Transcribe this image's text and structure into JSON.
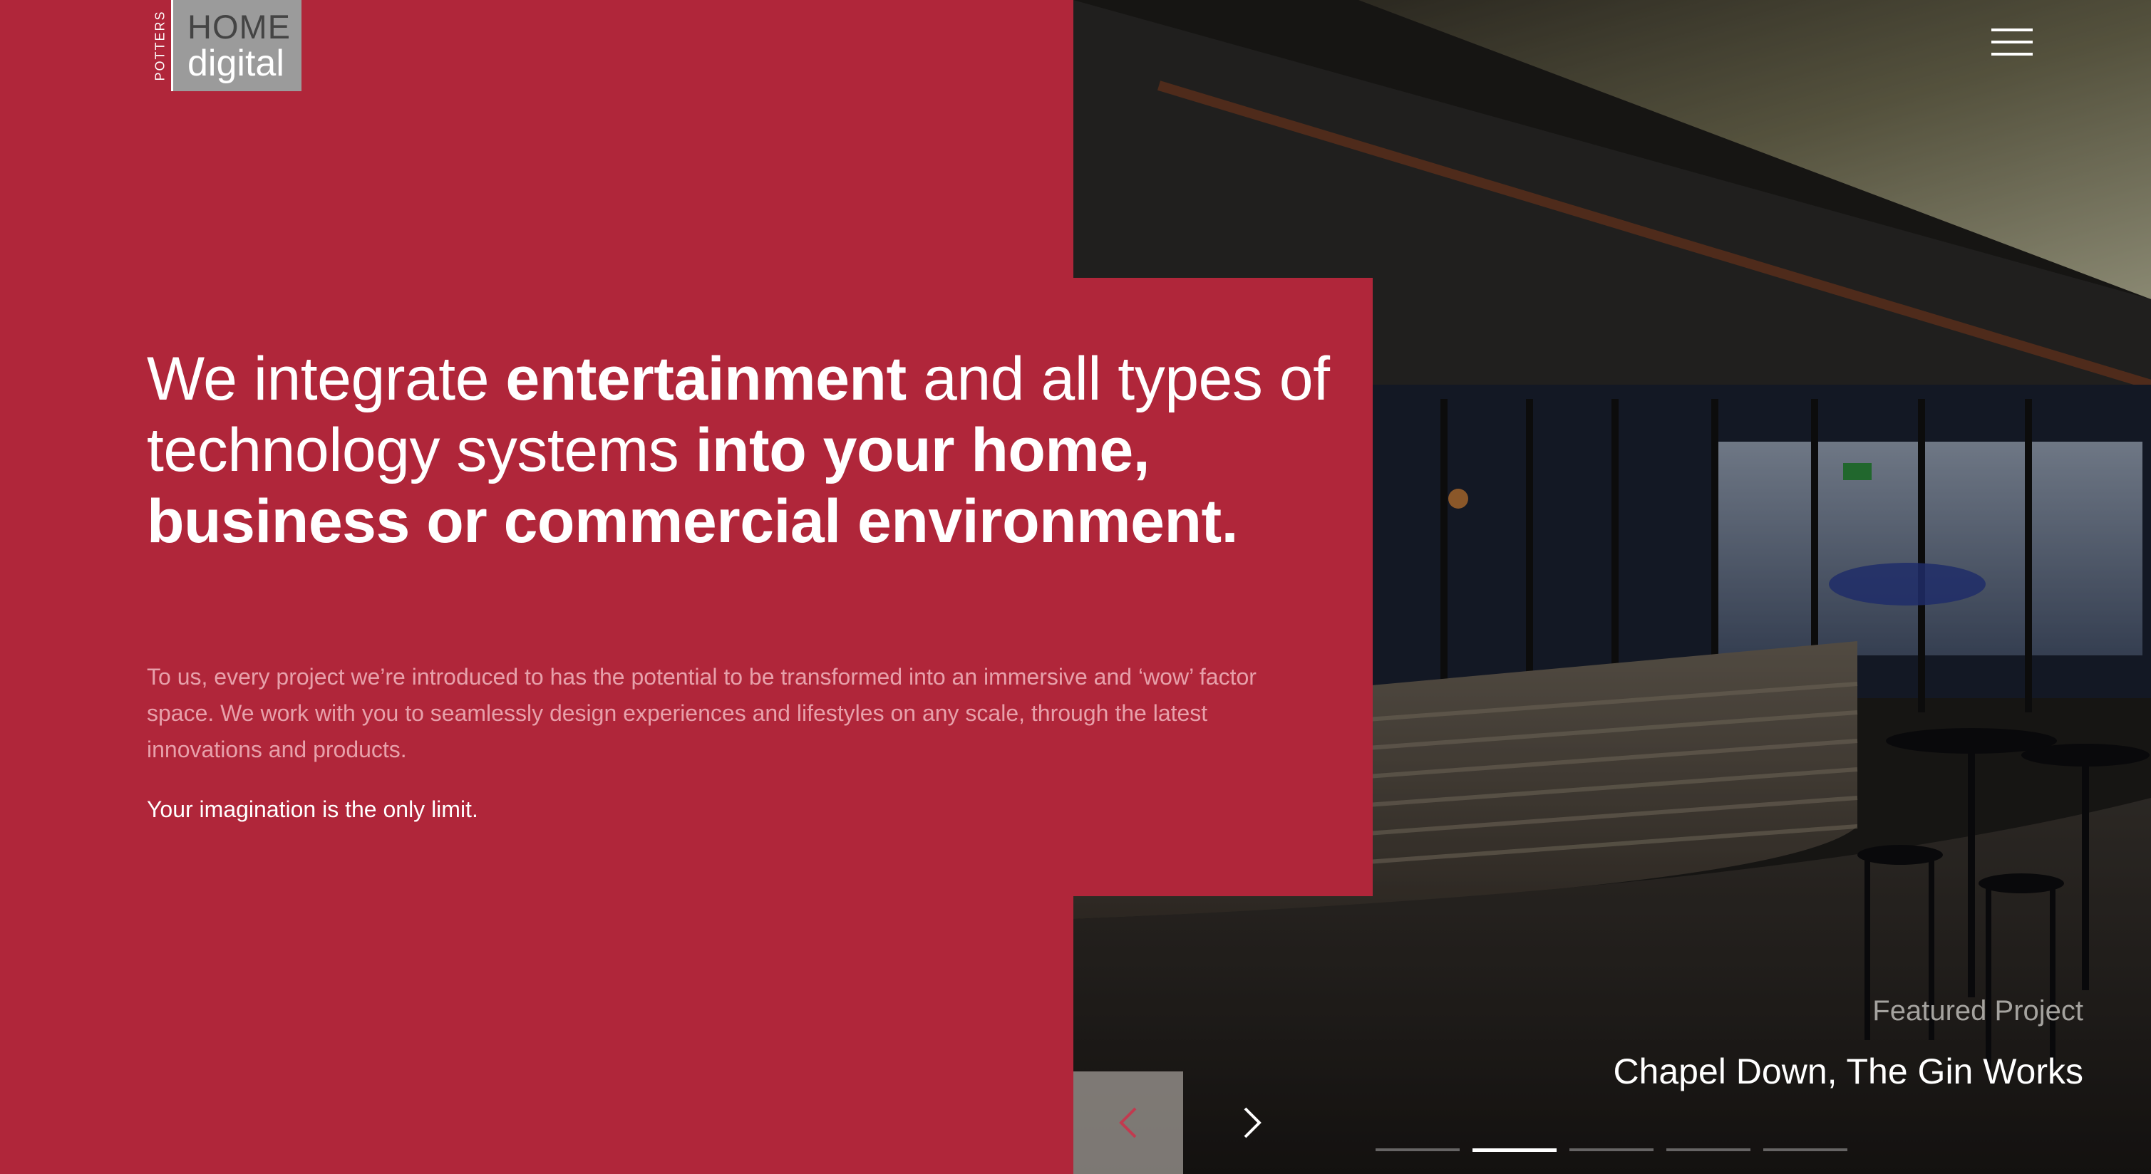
{
  "logo": {
    "side_text": "POTTERS",
    "line1": "HOME",
    "line2": "digital"
  },
  "menu": {
    "icon": "hamburger-menu-icon"
  },
  "hero": {
    "headline": [
      {
        "text": "We integrate ",
        "bold": false
      },
      {
        "text": "entertainment",
        "bold": true
      },
      {
        "text": " and all types of technology systems ",
        "bold": false
      },
      {
        "text": "into your home, business or commercial environment.",
        "bold": true
      }
    ],
    "intro": "To us, every project we’re introduced to has the potential to be transformed into an immersive and ‘wow’ factor space. We work with you to seamlessly design experiences and lifestyles on any scale, through the latest innovations and products.",
    "tagline": "Your imagination is the only limit."
  },
  "featured": {
    "label": "Featured Project",
    "title": "Chapel Down, The Gin Works"
  },
  "slider": {
    "prev_icon": "chevron-left-icon",
    "next_icon": "chevron-right-icon",
    "total_slides": 5,
    "active_slide": 2
  },
  "colors": {
    "brand_red": "#b0263a",
    "logo_grey": "#9b9b9b"
  }
}
